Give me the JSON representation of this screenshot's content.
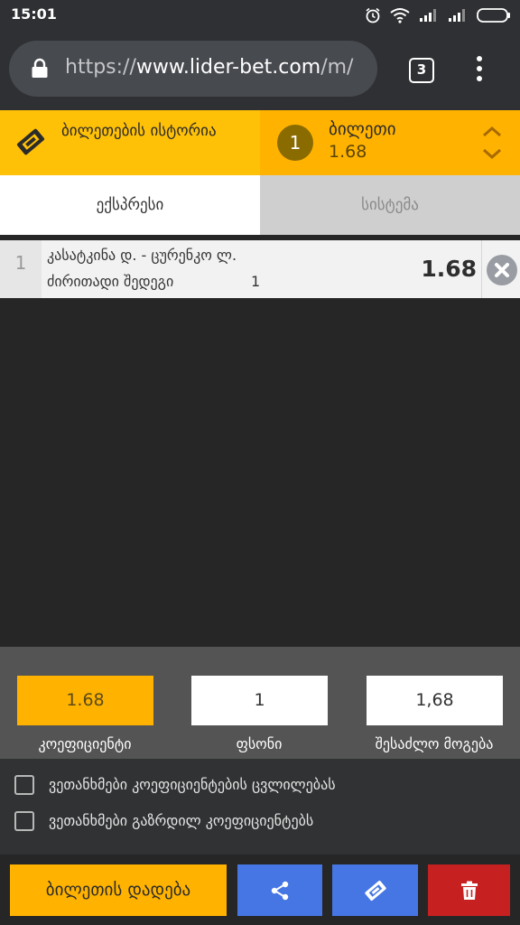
{
  "status_bar": {
    "time": "15:01",
    "icons": [
      "alarm-icon",
      "wifi-icon",
      "signal-icon",
      "signal-icon",
      "battery-icon"
    ]
  },
  "browser": {
    "url_scheme": "https://",
    "url_host": "www.lider-bet.com",
    "url_rest": "/m/",
    "tab_count": "3"
  },
  "header": {
    "history_label": "ბილეთების ისტორია",
    "ticket_count": "1",
    "ticket_label": "ბილეთი",
    "ticket_total_odds": "1.68",
    "colors": {
      "left": "#ffc107",
      "right": "#ffb300"
    }
  },
  "bet_tabs": [
    {
      "label": "ექსპრესი",
      "active": true
    },
    {
      "label": "სისტემა",
      "active": false
    }
  ],
  "selections": [
    {
      "index": "1",
      "match": "კასატკინა დ. - ცურენკო ლ.",
      "market": "ძირითადი შედეგი",
      "outcome": "1",
      "odds": "1.68"
    }
  ],
  "stake_panel": {
    "odds_value": "1.68",
    "odds_label": "კოეფიციენტი",
    "stake_value": "1",
    "stake_label": "ფსონი",
    "win_value": "1,68",
    "win_label": "შესაძლო მოგება"
  },
  "agreements": [
    {
      "label": "ვეთანხმები კოეფიციენტების ცვლილებას",
      "checked": false
    },
    {
      "label": "ვეთანხმები გაზრდილ კოეფიციენტებს",
      "checked": false
    }
  ],
  "actions": {
    "place_label": "ბილეთის დადება",
    "colors": {
      "place": "#ffb300",
      "share": "#4676e3",
      "ticket": "#4676e3",
      "delete": "#c62020"
    }
  }
}
